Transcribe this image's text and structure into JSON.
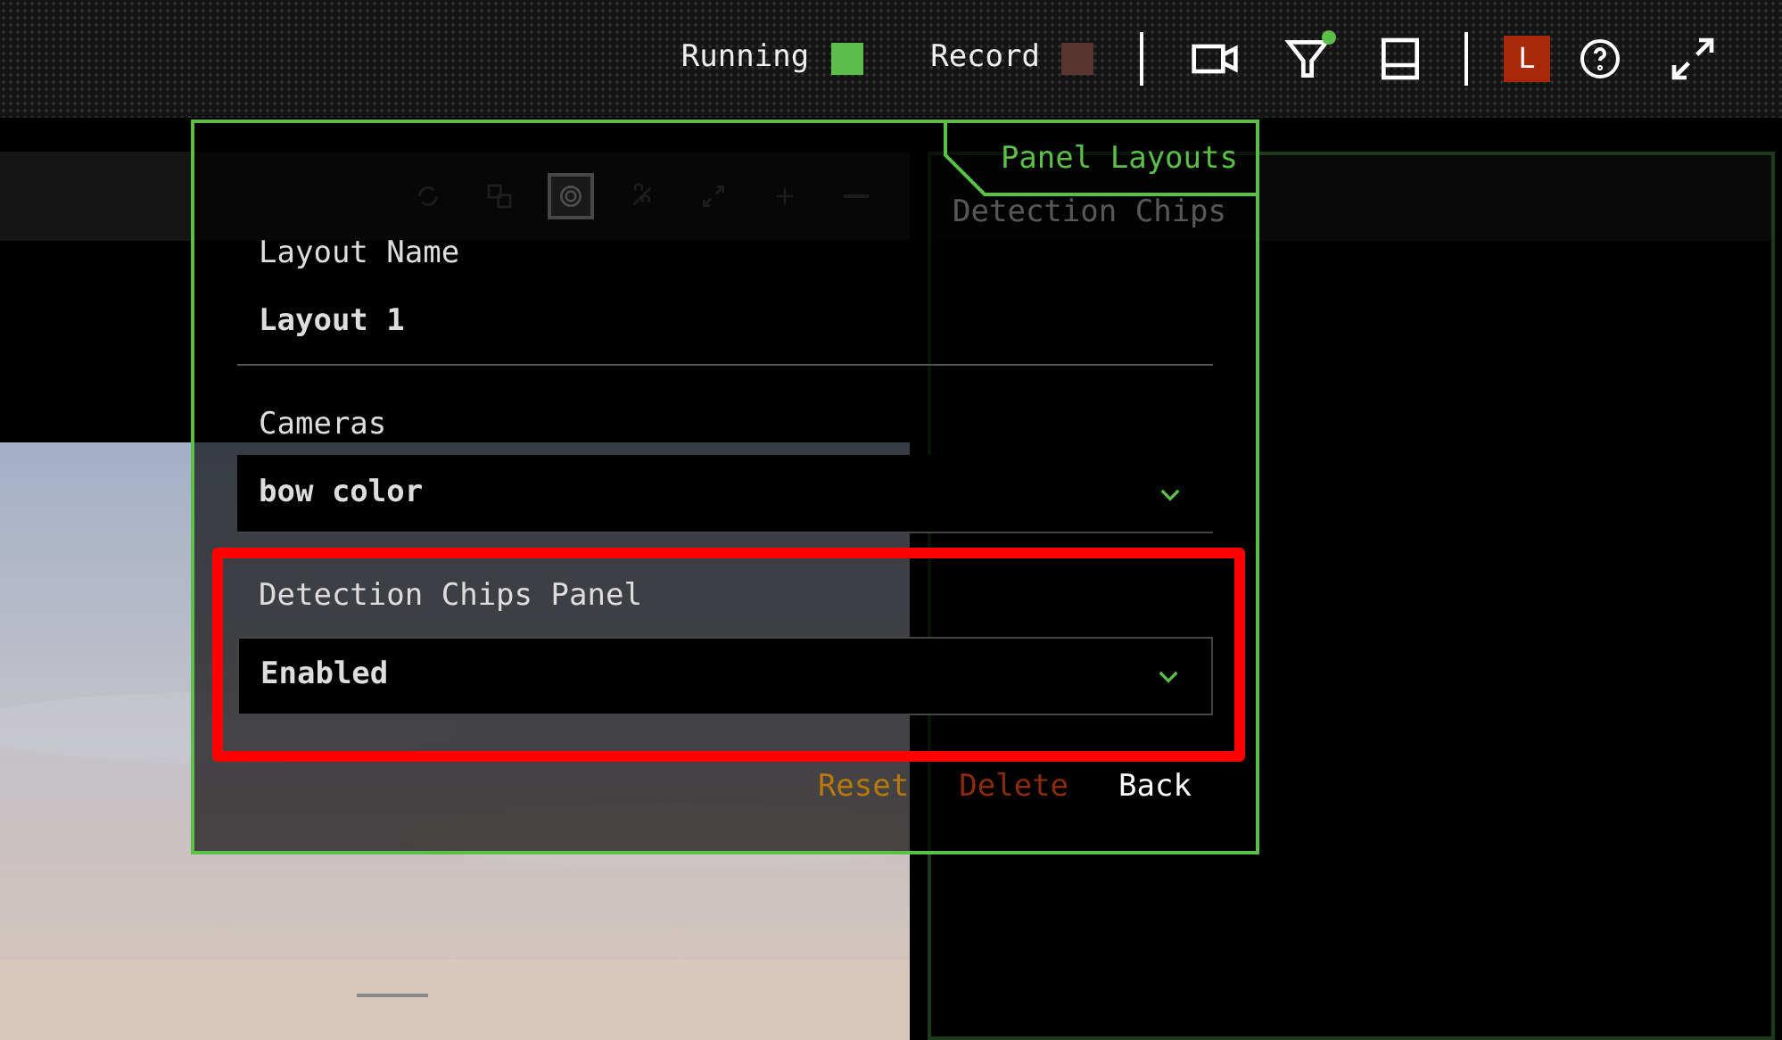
{
  "top_bar": {
    "indicators": [
      {
        "label": "Running",
        "color": "#5cbf4a"
      },
      {
        "label": "Record",
        "color": "#5a3630"
      }
    ],
    "tools": [
      {
        "kind": "camera"
      },
      {
        "kind": "filter",
        "alert": true
      },
      {
        "kind": "panel"
      }
    ],
    "user_initial": "L"
  },
  "camera_panel": {
    "toolbar": [
      {
        "kind": "rotate",
        "selected": false
      },
      {
        "kind": "squares",
        "selected": false
      },
      {
        "kind": "target",
        "selected": true
      },
      {
        "kind": "crossed",
        "selected": false
      },
      {
        "kind": "expand",
        "selected": false
      },
      {
        "kind": "plus",
        "selected": false
      },
      {
        "kind": "minus",
        "selected": false
      }
    ]
  },
  "chips_panel": {
    "title": "Detection Chips"
  },
  "dialog": {
    "tab": "Panel Layouts",
    "fields": [
      {
        "kind": "text",
        "label": "Layout Name",
        "value": "Layout 1",
        "highlighted": false
      },
      {
        "kind": "select",
        "label": "Cameras",
        "value": "bow color",
        "highlighted": false
      },
      {
        "kind": "select",
        "label": "Detection Chips Panel",
        "value": "Enabled",
        "highlighted": true
      }
    ],
    "actions": [
      {
        "kind": "reset",
        "label": "Reset"
      },
      {
        "kind": "delete",
        "label": "Delete"
      },
      {
        "kind": "back",
        "label": "Back"
      }
    ]
  }
}
